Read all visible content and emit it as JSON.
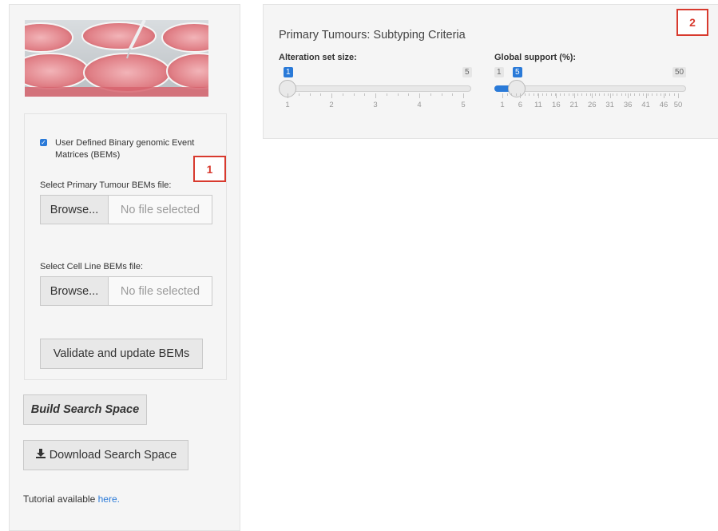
{
  "sidebar": {
    "banner_alt": "petri dishes image",
    "checkbox_label": "User Defined Binary genomic Event Matrices (BEMs)",
    "checkbox_checked": true,
    "primary_label": "Select Primary Tumour BEMs file:",
    "cellline_label": "Select Cell Line BEMs file:",
    "browse_label": "Browse...",
    "no_file_label": "No file selected",
    "validate_label": "Validate and update BEMs",
    "build_label": "Build Search Space",
    "download_label": "Download Search Space",
    "download_icon": "download-icon",
    "tutorial_text": "Tutorial available ",
    "tutorial_link": "here."
  },
  "markers": {
    "one": "1",
    "two": "2"
  },
  "panel": {
    "title": "Primary Tumours: Subtyping Criteria",
    "slider1": {
      "label": "Alteration set size:",
      "min": 1,
      "max": 5,
      "value": 1,
      "min_label": "1",
      "max_label": "5",
      "ticks": [
        "1",
        "2",
        "3",
        "4",
        "5"
      ]
    },
    "slider2": {
      "label": "Global support (%):",
      "min": 1,
      "max": 50,
      "value": 5,
      "min_label": "1",
      "max_label": "50",
      "ticks": [
        "1",
        "6",
        "11",
        "16",
        "21",
        "26",
        "31",
        "36",
        "41",
        "46",
        "50"
      ]
    }
  },
  "colors": {
    "accent": "#2a7ad8",
    "marker": "#d83a2e"
  }
}
